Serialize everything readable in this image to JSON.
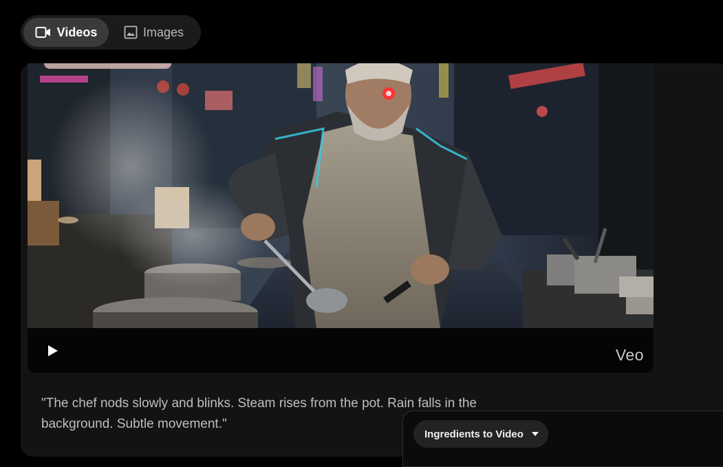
{
  "tabs": {
    "videos_label": "Videos",
    "images_label": "Images",
    "active": "Videos"
  },
  "video": {
    "watermark": "Veo",
    "play_icon": "play-icon",
    "thumbnail_description_icon": "video-thumbnail"
  },
  "prompt_text": "\"The chef nods slowly and blinks. Steam rises from the pot. Rain falls in the background. Subtle movement.\"",
  "mode_selector": {
    "label": "Ingredients to Video",
    "icon": "chevron-down-icon"
  },
  "colors": {
    "background": "#000000",
    "card": "#131313",
    "active_tab": "#3a3a3a"
  }
}
